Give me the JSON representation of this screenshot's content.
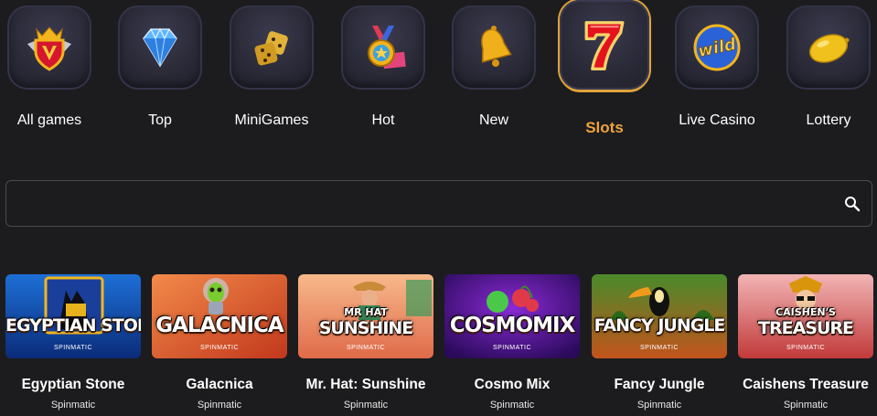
{
  "categories": [
    {
      "label": "All games",
      "icon": "crown-shield-icon",
      "active": false
    },
    {
      "label": "Top",
      "icon": "diamond-icon",
      "active": false
    },
    {
      "label": "MiniGames",
      "icon": "dice-icon",
      "active": false
    },
    {
      "label": "Hot",
      "icon": "medal-icon",
      "active": false
    },
    {
      "label": "New",
      "icon": "bell-icon",
      "active": false
    },
    {
      "label": "Slots",
      "icon": "seven-icon",
      "active": true
    },
    {
      "label": "Live Casino",
      "icon": "wild-icon",
      "active": false
    },
    {
      "label": "Lottery",
      "icon": "lemon-icon",
      "active": false
    }
  ],
  "colors": {
    "background": "#1c1c1e",
    "accent": "#f0a23c",
    "tile": "#2a2a38",
    "search_border": "#4a4a52"
  },
  "search": {
    "value": "",
    "placeholder": "",
    "icon": "search-icon"
  },
  "games": [
    {
      "title": "Egyptian Stone",
      "provider": "Spinmatic",
      "logo": "EGYPTIAN STONE",
      "logo_pre": "",
      "thumb_provider": "SPINMATIC"
    },
    {
      "title": "Galacnica",
      "provider": "Spinmatic",
      "logo": "GALACNICA",
      "logo_pre": "",
      "thumb_provider": "SPINMATIC"
    },
    {
      "title": "Mr. Hat: Sunshine",
      "provider": "Spinmatic",
      "logo": "SUNSHINE",
      "logo_pre": "MR HAT",
      "thumb_provider": "SPINMATIC"
    },
    {
      "title": "Cosmo Mix",
      "provider": "Spinmatic",
      "logo": "COSMOMIX",
      "logo_pre": "",
      "thumb_provider": "SPINMATIC"
    },
    {
      "title": "Fancy Jungle",
      "provider": "Spinmatic",
      "logo": "FANCY JUNGLE",
      "logo_pre": "",
      "thumb_provider": "SPINMATIC"
    },
    {
      "title": "Caishens Treasure",
      "provider": "Spinmatic",
      "logo": "TREASURE",
      "logo_pre": "CAISHEN'S",
      "thumb_provider": "SPINMATIC"
    }
  ]
}
